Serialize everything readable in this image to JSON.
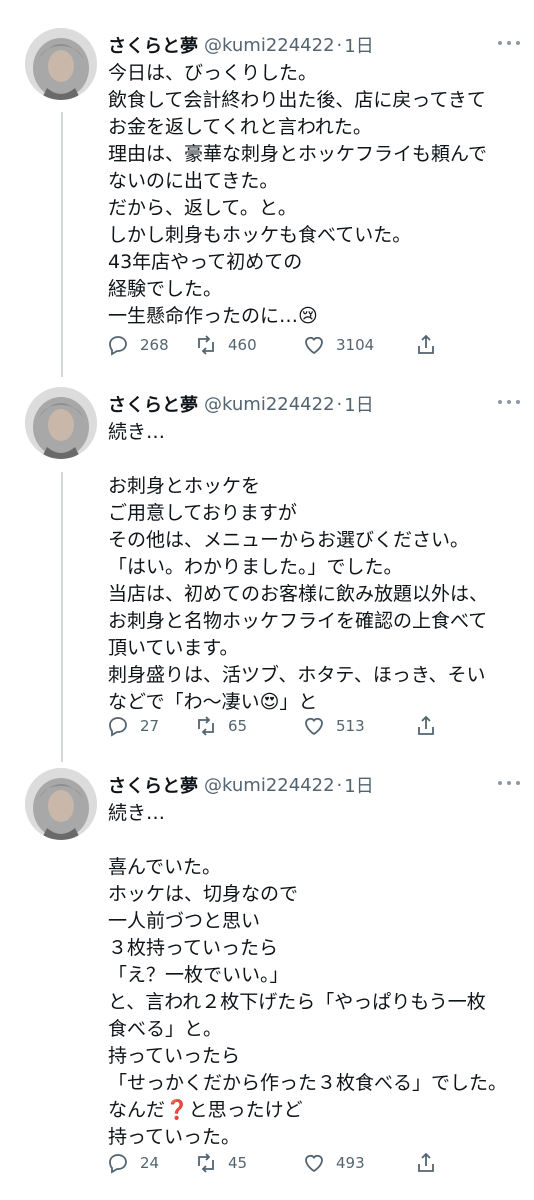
{
  "tweets": [
    {
      "name": "さくらと夢",
      "handle": "@kumi224422",
      "time": "1日",
      "lines": [
        "今日は、びっくりした。",
        "飲食して会計終わり出た後、店に戻ってきて",
        "お金を返してくれと言われた。",
        "理由は、豪華な刺身とホッケフライも頼んで",
        "ないのに出てきた。",
        "だから、返して。と。",
        "しかし刺身もホッケも食べていた。",
        "43年店やって初めての",
        "経験でした。",
        "一生懸命作ったのに…😢"
      ],
      "reply_count": "268",
      "retweet_count": "460",
      "like_count": "3104"
    },
    {
      "name": "さくらと夢",
      "handle": "@kumi224422",
      "time": "1日",
      "lines": [
        "続き…",
        "",
        "お刺身とホッケを",
        "ご用意しておりますが",
        "その他は、メニューからお選びください。",
        "「はい。わかりました。」でした。",
        "当店は、初めてのお客様に飲み放題以外は、",
        "お刺身と名物ホッケフライを確認の上食べて",
        "頂いています。",
        "刺身盛りは、活ツブ、ホタテ、ほっき、そい",
        "などで「わ〜凄い😍」と"
      ],
      "reply_count": "27",
      "retweet_count": "65",
      "like_count": "513"
    },
    {
      "name": "さくらと夢",
      "handle": "@kumi224422",
      "time": "1日",
      "lines": [
        "続き…",
        "",
        "喜んでいた。",
        "ホッケは、切身なので",
        "一人前づつと思い",
        "３枚持っていったら",
        "「え？一枚でいい。」",
        "と、言われ２枚下げたら「やっぱりもう一枚",
        "食べる」と。",
        "持っていったら",
        "「せっかくだから作った３枚食べる」でした。",
        "なんだ❓と思ったけど",
        "持っていった。"
      ],
      "reply_count": "24",
      "retweet_count": "45",
      "like_count": "493"
    }
  ],
  "separator": "·",
  "icons": [
    "avatar",
    "more-icon",
    "reply-icon",
    "retweet-icon",
    "like-icon",
    "share-icon"
  ],
  "colors": {
    "text": "#0f1419",
    "secondary": "#536471",
    "thread_line": "#cfd9de"
  }
}
